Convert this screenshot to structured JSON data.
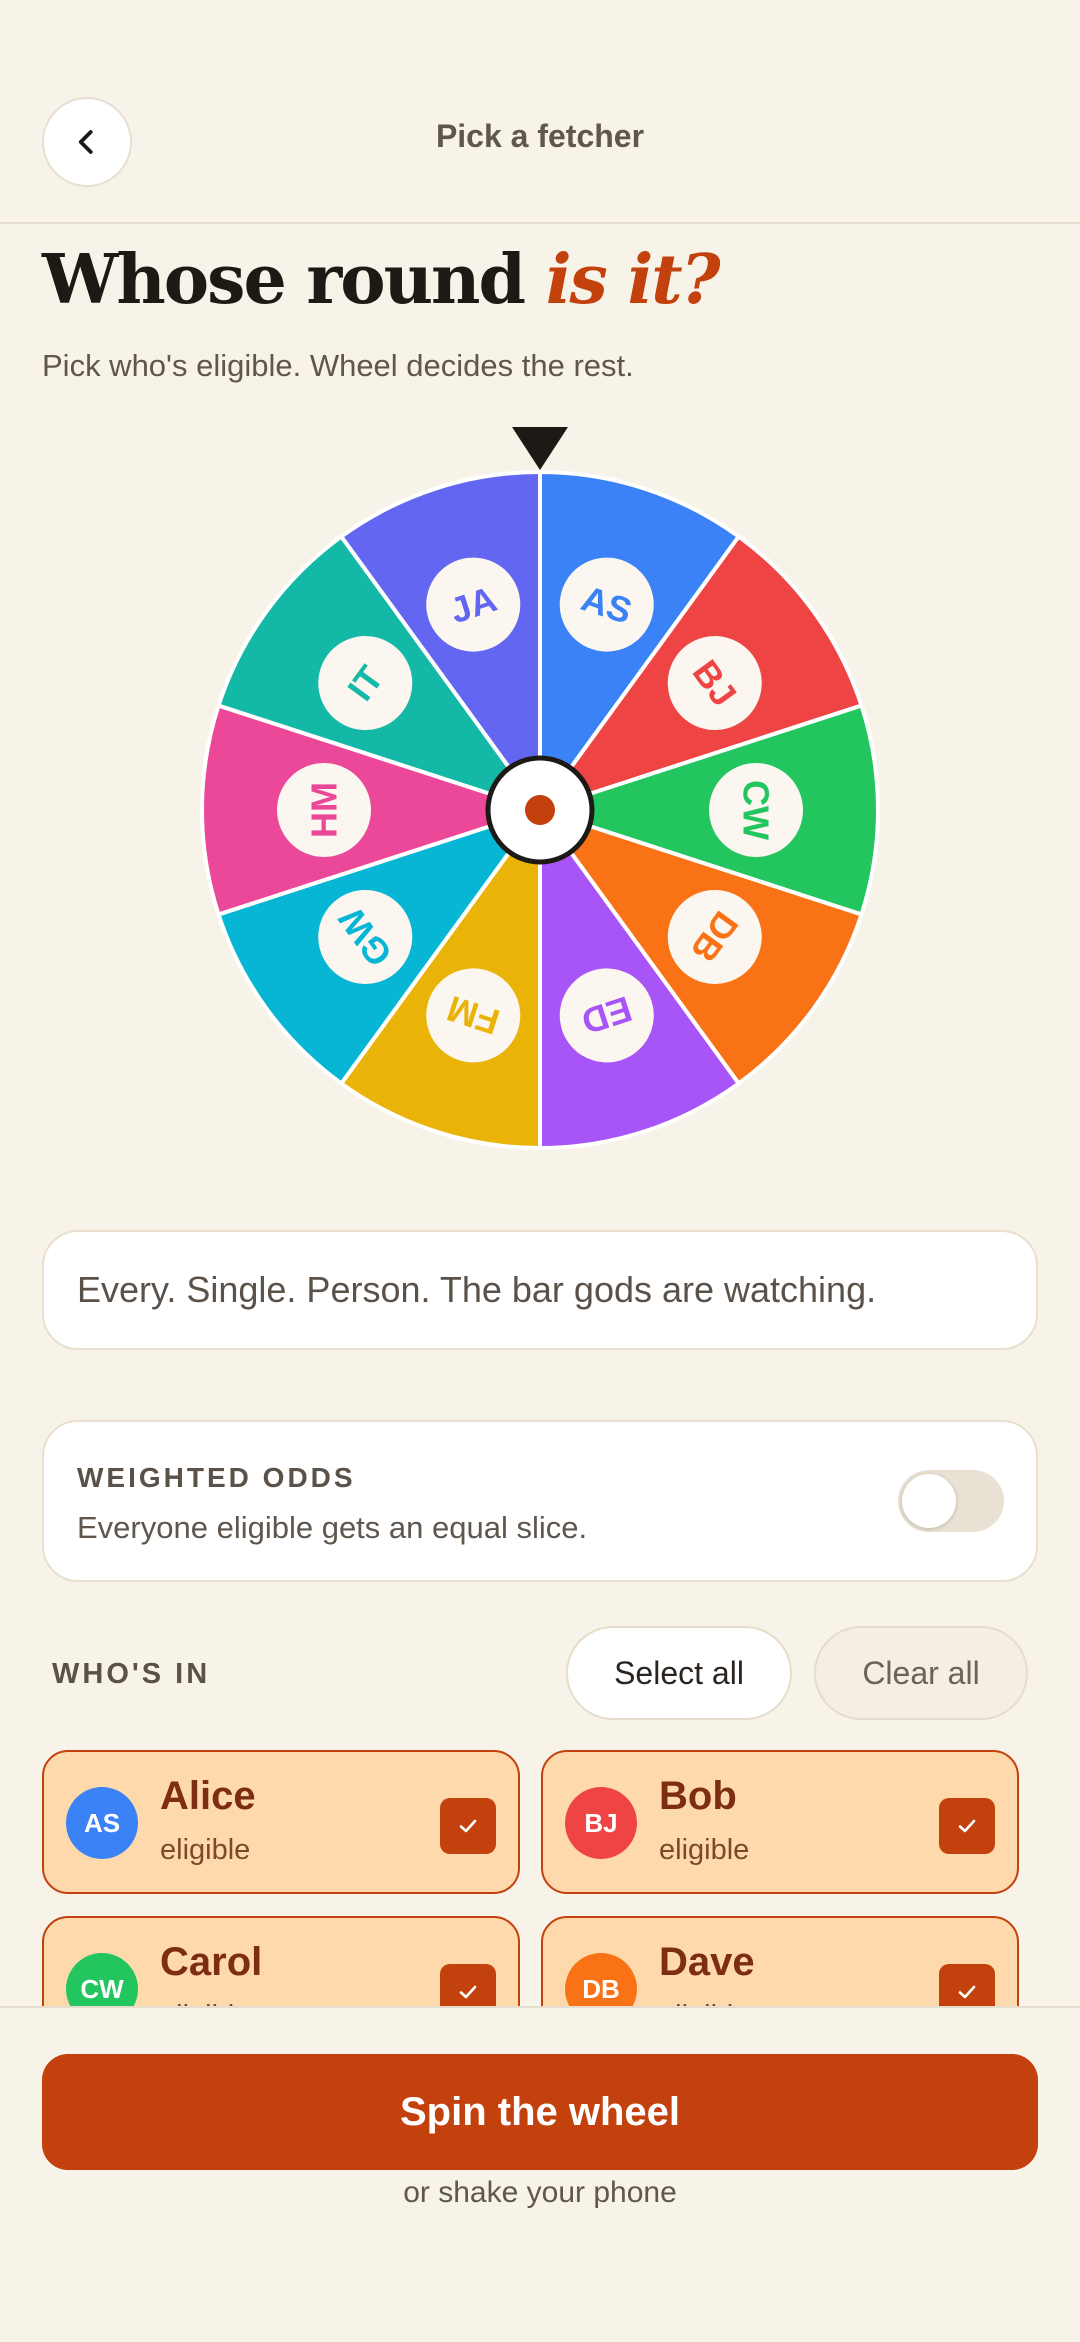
{
  "header": {
    "title": "Pick a fetcher",
    "back_icon": "chevron-left-icon"
  },
  "hero": {
    "title_main": "Whose round",
    "title_accent": "is it?",
    "subtitle": "Pick who's eligible. Wheel decides the rest."
  },
  "wheel": {
    "pointer_icon": "triangle-down-icon",
    "segments": [
      {
        "initials": "AS",
        "color": "#3b82f6"
      },
      {
        "initials": "BJ",
        "color": "#ef4444"
      },
      {
        "initials": "CW",
        "color": "#22c55e"
      },
      {
        "initials": "DB",
        "color": "#f97316"
      },
      {
        "initials": "ED",
        "color": "#a855f7"
      },
      {
        "initials": "FM",
        "color": "#eab308"
      },
      {
        "initials": "GW",
        "color": "#06b6d4"
      },
      {
        "initials": "HM",
        "color": "#ec4899"
      },
      {
        "initials": "IT",
        "color": "#14b8a6"
      },
      {
        "initials": "JA",
        "color": "#6366f1"
      }
    ],
    "hub_color": "#c2410c"
  },
  "quote": {
    "text": "Every. Single. Person. The bar gods are watching."
  },
  "weighted": {
    "title": "WEIGHTED ODDS",
    "description": "Everyone eligible gets an equal slice.",
    "enabled": false
  },
  "whos_in": {
    "label": "WHO'S IN",
    "select_all_label": "Select all",
    "clear_all_label": "Clear all",
    "people": [
      {
        "initials": "AS",
        "name": "Alice",
        "status": "eligible",
        "color": "#3b82f6",
        "checked": true
      },
      {
        "initials": "BJ",
        "name": "Bob",
        "status": "eligible",
        "color": "#ef4444",
        "checked": true
      },
      {
        "initials": "CW",
        "name": "Carol",
        "status": "eligible",
        "color": "#22c55e",
        "checked": true
      },
      {
        "initials": "DB",
        "name": "Dave",
        "status": "eligible",
        "color": "#f97316",
        "checked": true
      }
    ]
  },
  "actions": {
    "spin_label": "Spin the wheel",
    "shake_hint": "or shake your phone"
  },
  "colors": {
    "accent": "#c2410c",
    "background": "#f8f3e8",
    "card_selected": "#fdd9ab"
  }
}
